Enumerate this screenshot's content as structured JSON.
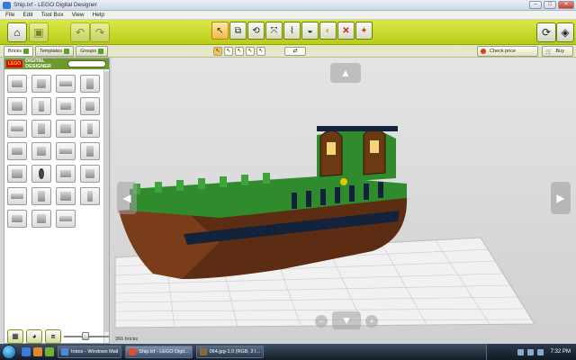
{
  "window": {
    "title": "Ship.lxf - LEGO Digital Designer",
    "controls": {
      "minimize": "–",
      "maximize": "□",
      "close": "✕"
    }
  },
  "menu": [
    "File",
    "Edit",
    "Tool Box",
    "View",
    "Help"
  ],
  "toolbar": {
    "home_icon": "house-icon",
    "save_icon": "save-icon",
    "undo_icon": "undo-icon",
    "redo_icon": "redo-icon",
    "tools": [
      {
        "icon": "select-arrow-icon",
        "glyph": "↖"
      },
      {
        "icon": "clone-icon",
        "glyph": "⧉"
      },
      {
        "icon": "hinge-icon",
        "glyph": "⟲"
      },
      {
        "icon": "hinge-align-icon",
        "glyph": "⤧"
      },
      {
        "icon": "flex-icon",
        "glyph": "⌇"
      },
      {
        "icon": "paint-icon",
        "glyph": "◒"
      },
      {
        "icon": "hide-icon",
        "glyph": "◐"
      },
      {
        "icon": "delete-icon",
        "glyph": "✕"
      },
      {
        "icon": "decoration-icon",
        "glyph": "✦"
      }
    ],
    "right_icons": [
      "building-guide-icon",
      "view-mode-icon"
    ]
  },
  "subbar": {
    "tabs": [
      {
        "label": "Bricks",
        "icon": "bricks-tab-icon"
      },
      {
        "label": "Templates",
        "icon": "templates-tab-icon"
      },
      {
        "label": "Groups",
        "icon": "groups-tab-icon"
      }
    ],
    "mini_tools": [
      "↖",
      "↖",
      "↖",
      "↖",
      "↖"
    ],
    "wide_tool": "⇄",
    "check_price": "Check price",
    "buy": "Buy"
  },
  "panel": {
    "brand_logo": "LEGO",
    "brand_text": "DIGITAL DESIGNER",
    "brick_count": 27
  },
  "viewport": {
    "status": "366 bricks",
    "nav": {
      "up": "▲",
      "down": "▼",
      "left": "◀",
      "right": "▶",
      "zoom_out": "−",
      "zoom_in": "+"
    }
  },
  "taskbar": {
    "tasks": [
      {
        "label": "Inbox - Windows Mail",
        "color": "#4a8ad8"
      },
      {
        "label": "Ship.lxf - LEGO Digit...",
        "color": "#e34b2a"
      },
      {
        "label": "064.jpg-1.0 (RGB, 2 I...",
        "color": "#8a6a3a"
      }
    ],
    "clock": "7:32 PM"
  },
  "colors": {
    "toolbar": "#c8d82a",
    "hull_brown": "#5c2d12",
    "deck_green": "#2f8b2b",
    "grid_plate": "#f2f2f2"
  }
}
